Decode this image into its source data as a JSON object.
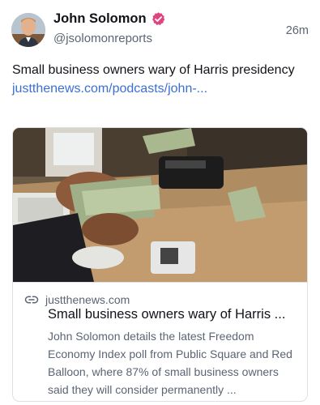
{
  "post": {
    "author": {
      "display_name": "John Solomon",
      "handle": "@jsolomonreports",
      "verified": true,
      "verified_color": "#e0447f"
    },
    "timestamp": "26m",
    "text": "Small business owners wary of Harris presidency ",
    "link_text": "justthenews.com/podcasts/john-...",
    "link_color": "#3b6fd6"
  },
  "link_card": {
    "domain": "justthenews.com",
    "title": "Small business owners wary of Harris ...",
    "description": "John Solomon details the latest Freedom Economy Index poll from Public Square and Red Balloon, where 87% of small business owners said they will consider permanently ...",
    "image_alt": "hands counting dollar bills at a cash register",
    "icon": "link-icon"
  }
}
